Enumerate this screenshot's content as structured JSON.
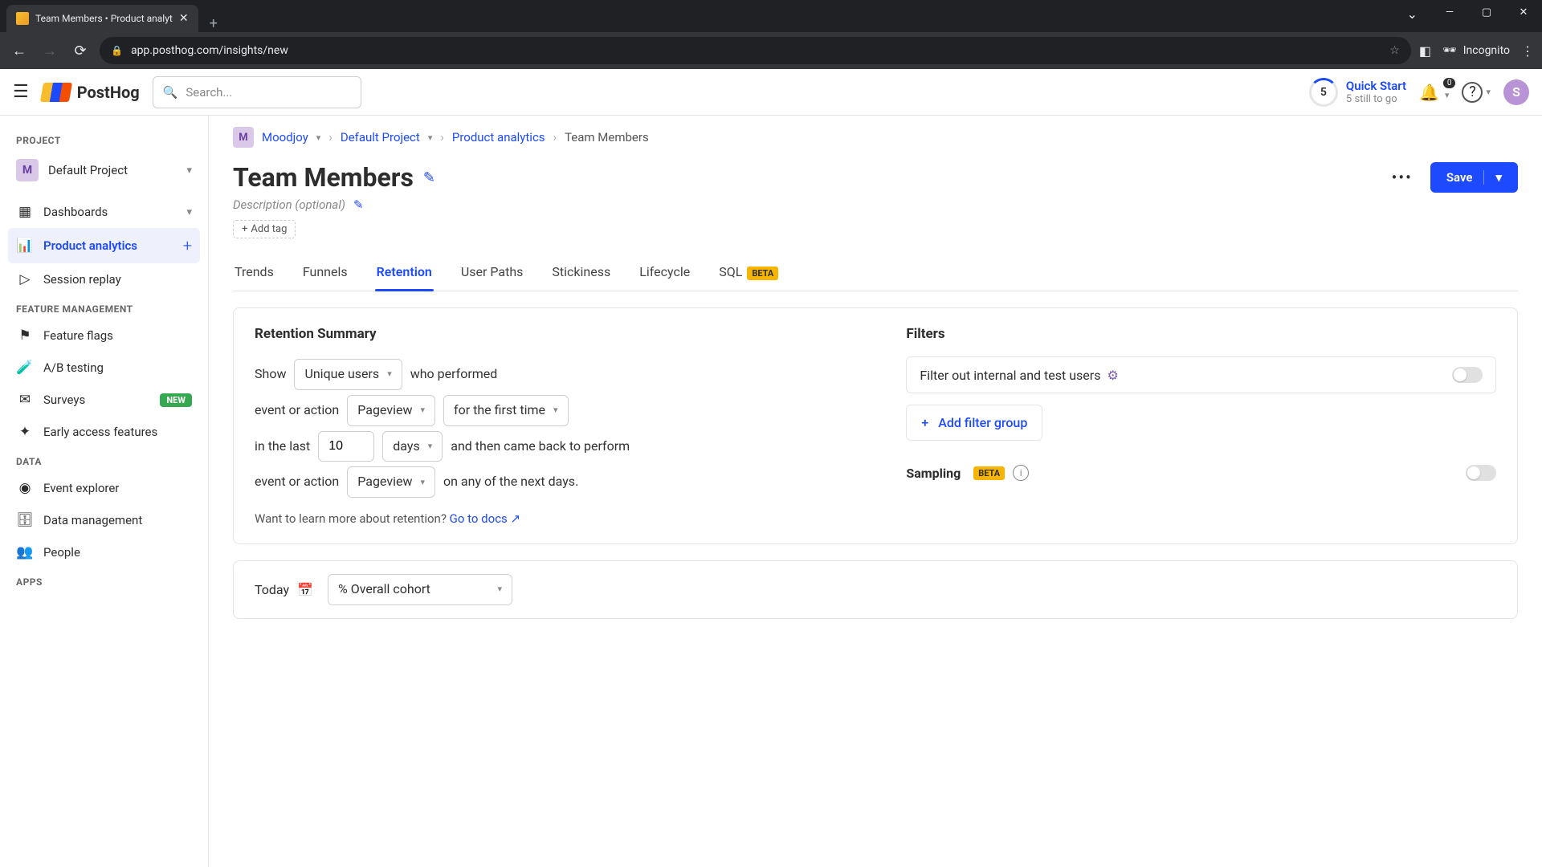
{
  "browser": {
    "tab_title": "Team Members • Product analyt",
    "url": "app.posthog.com/insights/new",
    "incognito": "Incognito"
  },
  "header": {
    "logo": "PostHog",
    "search_placeholder": "Search...",
    "quick_start": {
      "count": "5",
      "title": "Quick Start",
      "sub": "5 still to go"
    },
    "notif_count": "0",
    "avatar_letter": "S"
  },
  "sidebar": {
    "sections": {
      "project": {
        "label": "PROJECT",
        "badge": "M",
        "name": "Default Project"
      },
      "nav1": [
        {
          "icon": "▦",
          "label": "Dashboards",
          "trail": "▾"
        },
        {
          "icon": "⫮⫮⫮",
          "label": "Product analytics",
          "trail": "+",
          "active": true
        },
        {
          "icon": "▷",
          "label": "Session replay"
        }
      ],
      "feature": {
        "label": "FEATURE MANAGEMENT",
        "items": [
          {
            "icon": "⚑",
            "label": "Feature flags"
          },
          {
            "icon": "🧪",
            "label": "A/B testing"
          },
          {
            "icon": "✉",
            "label": "Surveys",
            "pill": "NEW"
          },
          {
            "icon": "✦",
            "label": "Early access features"
          }
        ]
      },
      "data": {
        "label": "DATA",
        "items": [
          {
            "icon": "(•)",
            "label": "Event explorer"
          },
          {
            "icon": "🗄",
            "label": "Data management"
          },
          {
            "icon": "👥",
            "label": "People"
          }
        ]
      },
      "apps": {
        "label": "APPS"
      }
    }
  },
  "breadcrumb": {
    "badge": "M",
    "items": [
      "Moodjoy",
      "Default Project",
      "Product analytics",
      "Team Members"
    ]
  },
  "page": {
    "title": "Team Members",
    "desc_placeholder": "Description (optional)",
    "add_tag": "Add tag",
    "more": "•••",
    "save": "Save"
  },
  "tabs": [
    "Trends",
    "Funnels",
    "Retention",
    "User Paths",
    "Stickiness",
    "Lifecycle"
  ],
  "tab_sql": "SQL",
  "tab_beta": "BETA",
  "retention": {
    "heading": "Retention Summary",
    "text": {
      "show": "Show",
      "who_performed": "who performed",
      "event_or_action": "event or action",
      "in_the_last": "in the last",
      "came_back": "and then came back to perform",
      "on_any": "on any of the next days.",
      "learn": "Want to learn more about retention?",
      "docs": "Go to docs"
    },
    "sel": {
      "unique_users": "Unique users",
      "pageview1": "Pageview",
      "first_time": "for the first time",
      "count": "10",
      "days": "days",
      "pageview2": "Pageview"
    }
  },
  "filters": {
    "heading": "Filters",
    "internal": "Filter out internal and test users",
    "add_group": "Add filter group",
    "sampling": "Sampling",
    "beta": "BETA"
  },
  "bottom": {
    "today": "Today",
    "cohort": "% Overall cohort"
  }
}
